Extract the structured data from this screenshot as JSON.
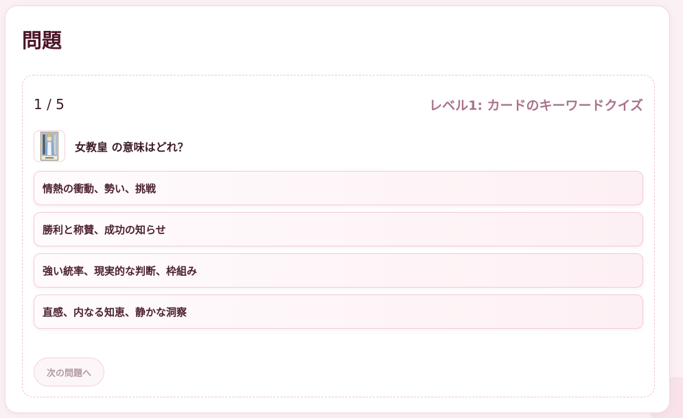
{
  "page": {
    "title": "問題"
  },
  "quiz": {
    "progress": "1 / 5",
    "level_title": "レベル1: カードのキーワードクイズ",
    "question": {
      "card_icon": "high-priestess-card-icon",
      "text": "女教皇 の意味はどれ？"
    },
    "options": [
      {
        "label": "情熱の衝動、勢い、挑戦"
      },
      {
        "label": "勝利と称賛、成功の知らせ"
      },
      {
        "label": "強い統率、現実的な判断、枠組み"
      },
      {
        "label": "直感、内なる知恵、静かな洞察"
      }
    ],
    "next_button_label": "次の問題へ"
  },
  "colors": {
    "title": "#4a1326",
    "accent": "#a8738c",
    "option_border": "#f0cad8",
    "background": "#fbf1f4"
  }
}
